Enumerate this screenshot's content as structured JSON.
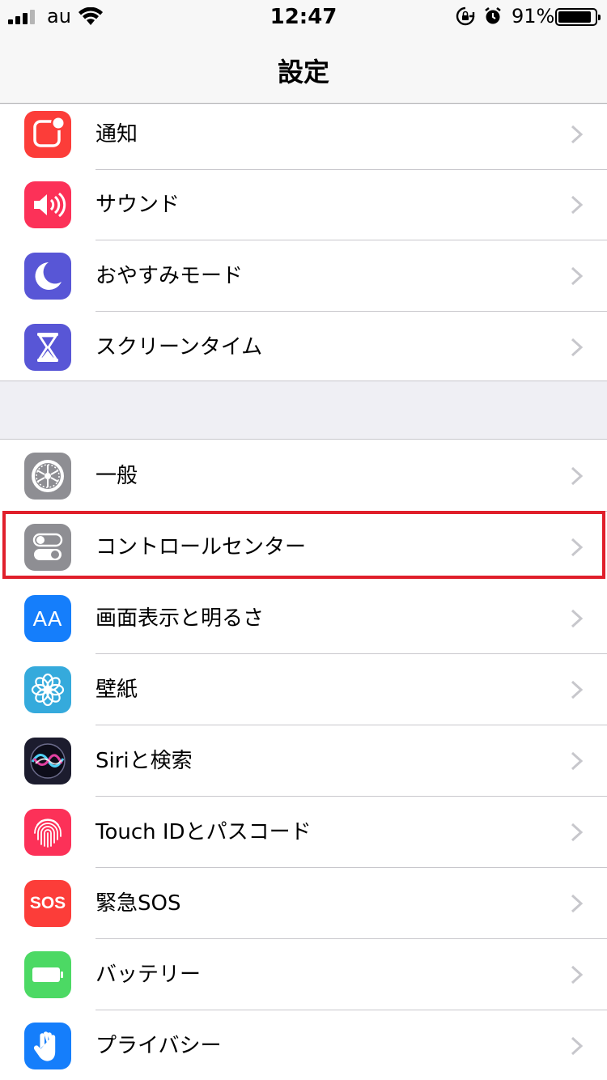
{
  "status_bar": {
    "carrier": "au",
    "time": "12:47",
    "battery_percent": "91%",
    "battery_level": 0.91
  },
  "nav": {
    "title": "設定"
  },
  "group1": [
    {
      "label": "通知",
      "icon": "notifications-icon",
      "color": "#fc3d39"
    },
    {
      "label": "サウンド",
      "icon": "sounds-icon",
      "color": "#fc3158"
    },
    {
      "label": "おやすみモード",
      "icon": "do-not-disturb-icon",
      "color": "#5856d6"
    },
    {
      "label": "スクリーンタイム",
      "icon": "screen-time-icon",
      "color": "#5856d6"
    }
  ],
  "group2": [
    {
      "label": "一般",
      "icon": "gear-icon",
      "color": "#8e8e93"
    },
    {
      "label": "コントロールセンター",
      "icon": "control-center-icon",
      "color": "#8e8e93"
    },
    {
      "label": "画面表示と明るさ",
      "icon": "display-brightness-icon",
      "color": "#157efb"
    },
    {
      "label": "壁紙",
      "icon": "wallpaper-icon",
      "color": "#35aadc"
    },
    {
      "label": "Siriと検索",
      "icon": "siri-icon",
      "color": "#1c1c2e"
    },
    {
      "label": "Touch IDとパスコード",
      "icon": "fingerprint-icon",
      "color": "#fc3158"
    },
    {
      "label": "緊急SOS",
      "icon": "sos-icon",
      "color": "#fc3d39"
    },
    {
      "label": "バッテリー",
      "icon": "battery-icon",
      "color": "#4cd964"
    },
    {
      "label": "プライバシー",
      "icon": "privacy-hand-icon",
      "color": "#157efb"
    }
  ],
  "sos_text": "SOS",
  "display_icon_text": "AA",
  "highlighted_item": "コントロールセンター"
}
